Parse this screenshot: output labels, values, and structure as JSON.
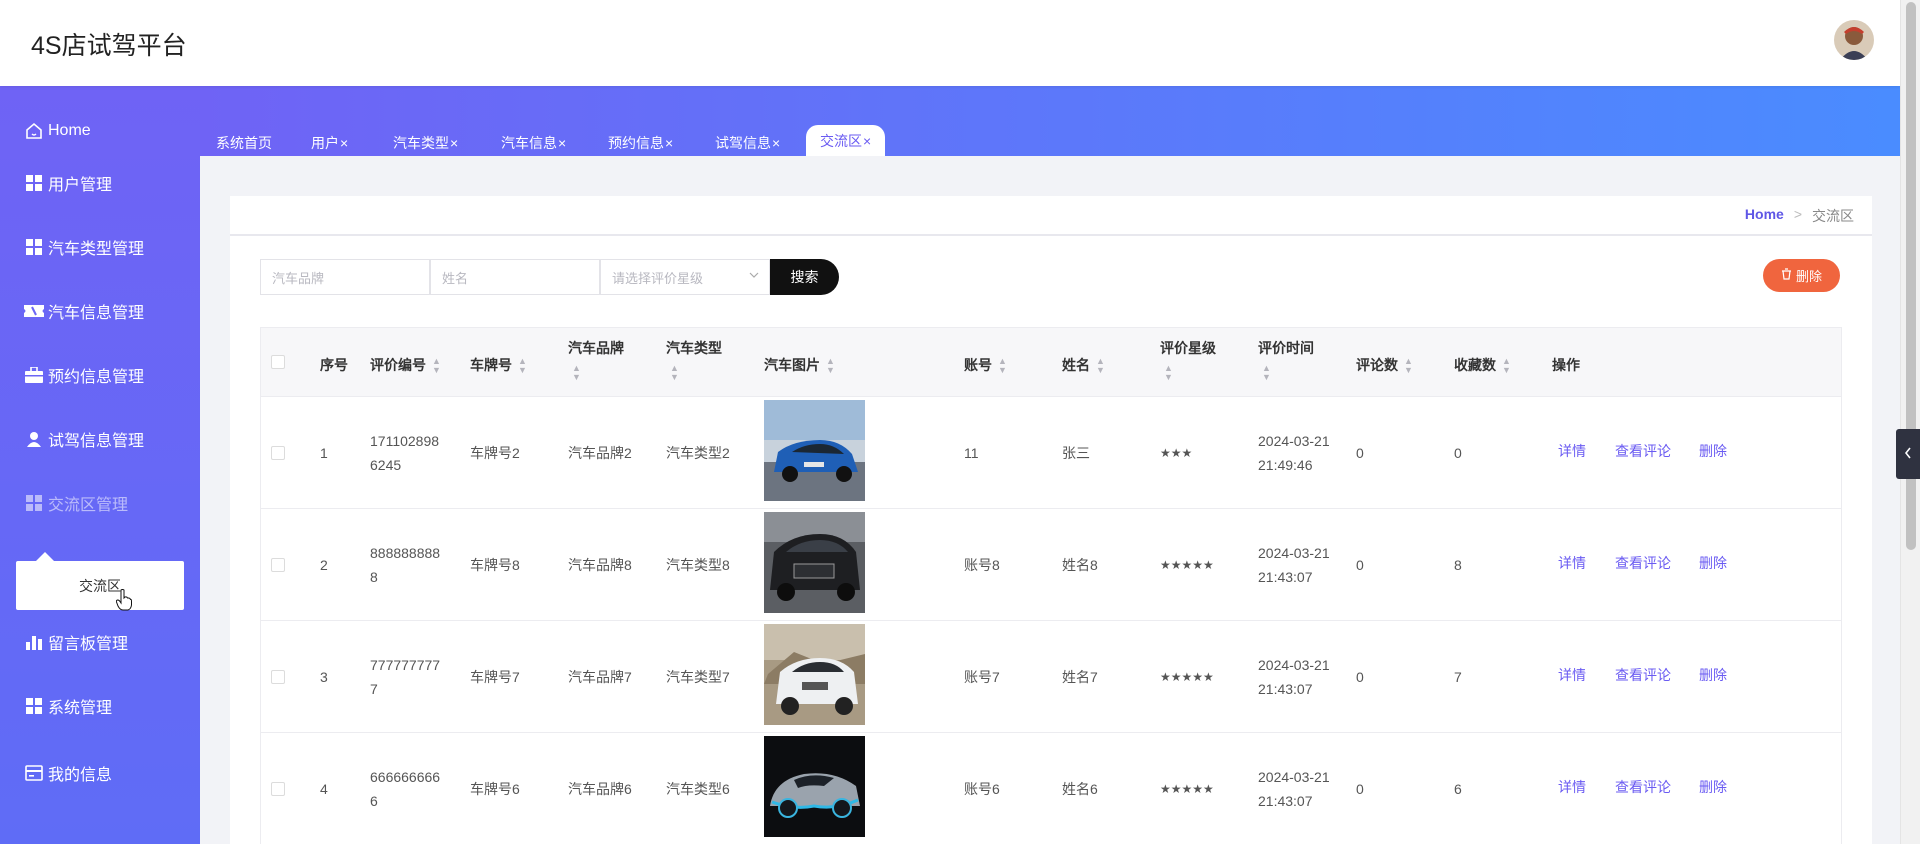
{
  "header": {
    "title": "4S店试驾平台"
  },
  "sidebar": {
    "items": [
      {
        "label": "Home",
        "icon": "home-icon"
      },
      {
        "label": "用户管理",
        "icon": "grid-icon"
      },
      {
        "label": "汽车类型管理",
        "icon": "grid-icon"
      },
      {
        "label": "汽车信息管理",
        "icon": "ticket-icon"
      },
      {
        "label": "预约信息管理",
        "icon": "briefcase-icon"
      },
      {
        "label": "试驾信息管理",
        "icon": "user-icon"
      },
      {
        "label": "交流区管理",
        "icon": "grid-icon"
      },
      {
        "label": "留言板管理",
        "icon": "bar-chart-icon"
      },
      {
        "label": "系统管理",
        "icon": "grid-icon"
      },
      {
        "label": "我的信息",
        "icon": "card-icon"
      }
    ],
    "popup_item": "交流区"
  },
  "tabs": [
    {
      "label": "系统首页",
      "closable": false
    },
    {
      "label": "用户",
      "closable": true
    },
    {
      "label": "汽车类型",
      "closable": true
    },
    {
      "label": "汽车信息",
      "closable": true
    },
    {
      "label": "预约信息",
      "closable": true
    },
    {
      "label": "试驾信息",
      "closable": true
    },
    {
      "label": "交流区",
      "closable": true,
      "active": true
    }
  ],
  "tab_close_glyph": "×",
  "breadcrumb": {
    "home": "Home",
    "separator": ">",
    "current": "交流区"
  },
  "filters": {
    "brand_placeholder": "汽车品牌",
    "name_placeholder": "姓名",
    "rating_placeholder": "请选择评价星级",
    "search_label": "搜索",
    "delete_label": "删除"
  },
  "table": {
    "headers": {
      "index": "序号",
      "review_id": "评价编号",
      "plate": "车牌号",
      "brand": "汽车品牌",
      "type": "汽车类型",
      "image": "汽车图片",
      "account": "账号",
      "name": "姓名",
      "rating": "评价星级",
      "time": "评价时间",
      "comments": "评论数",
      "favorites": "收藏数",
      "actions": "操作"
    },
    "rows": [
      {
        "index": "1",
        "review_id_1": "171102898",
        "review_id_2": "6245",
        "plate": "车牌号2",
        "brand": "汽车品牌2",
        "type": "汽车类型2",
        "account": "11",
        "name": "张三",
        "rating": "★★★",
        "date": "2024-03-21",
        "time": "21:49:46",
        "comments": "0",
        "favorites": "0"
      },
      {
        "index": "2",
        "review_id_1": "888888888",
        "review_id_2": "8",
        "plate": "车牌号8",
        "brand": "汽车品牌8",
        "type": "汽车类型8",
        "account": "账号8",
        "name": "姓名8",
        "rating": "★★★★★",
        "date": "2024-03-21",
        "time": "21:43:07",
        "comments": "0",
        "favorites": "8"
      },
      {
        "index": "3",
        "review_id_1": "777777777",
        "review_id_2": "7",
        "plate": "车牌号7",
        "brand": "汽车品牌7",
        "type": "汽车类型7",
        "account": "账号7",
        "name": "姓名7",
        "rating": "★★★★★",
        "date": "2024-03-21",
        "time": "21:43:07",
        "comments": "0",
        "favorites": "7"
      },
      {
        "index": "4",
        "review_id_1": "666666666",
        "review_id_2": "6",
        "plate": "车牌号6",
        "brand": "汽车品牌6",
        "type": "汽车类型6",
        "account": "账号6",
        "name": "姓名6",
        "rating": "★★★★★",
        "date": "2024-03-21",
        "time": "21:43:07",
        "comments": "0",
        "favorites": "6"
      }
    ],
    "actions": {
      "detail": "详情",
      "comments": "查看评论",
      "delete": "删除"
    }
  },
  "colors": {
    "accent": "#6a5bf2",
    "sidebar": "#6f63f5",
    "danger": "#f0653e"
  }
}
